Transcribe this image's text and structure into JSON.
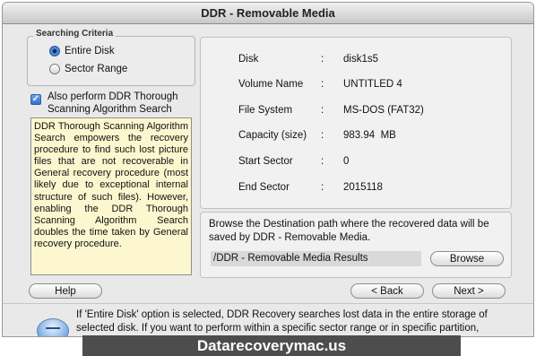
{
  "window": {
    "title": "DDR - Removable Media"
  },
  "search": {
    "legend": "Searching Criteria",
    "options": [
      {
        "label": "Entire Disk",
        "selected": true
      },
      {
        "label": "Sector Range",
        "selected": false
      }
    ],
    "thorough_label": "Also perform DDR Thorough Scanning Algorithm Search",
    "thorough_checked": true,
    "info": "DDR Thorough Scanning Algorithm Search empowers the recovery procedure to find such lost picture files that are not recoverable in General recovery procedure (most likely due to exceptional internal structure of such files). However, enabling the DDR Thorough Scanning Algorithm Search doubles the time taken by General recovery procedure."
  },
  "disk_info": {
    "rows": [
      {
        "key": "Disk",
        "sep": ":",
        "value": "disk1s5"
      },
      {
        "key": "Volume Name",
        "sep": ":",
        "value": "UNTITLED 4"
      },
      {
        "key": "File System",
        "sep": ":",
        "value": "MS-DOS (FAT32)"
      },
      {
        "key": "Capacity (size)",
        "sep": ":",
        "value": "983.94  MB"
      },
      {
        "key": "Start Sector",
        "sep": ":",
        "value": "0"
      },
      {
        "key": "End Sector",
        "sep": ":",
        "value": "2015118"
      }
    ]
  },
  "destination": {
    "text": "Browse the Destination path where the recovered data will be saved by DDR - Removable Media.",
    "path": "/DDR - Removable Media Results",
    "browse_label": "Browse"
  },
  "nav": {
    "help_label": "Help",
    "back_label": "< Back",
    "next_label": "Next >"
  },
  "footer": {
    "help_text": "If 'Entire Disk' option is selected, DDR Recovery searches lost data in the entire storage of selected disk. If you want to perform within a specific sector range or in specific partition,"
  },
  "banner": {
    "text": "Datarecoverymac.us"
  }
}
